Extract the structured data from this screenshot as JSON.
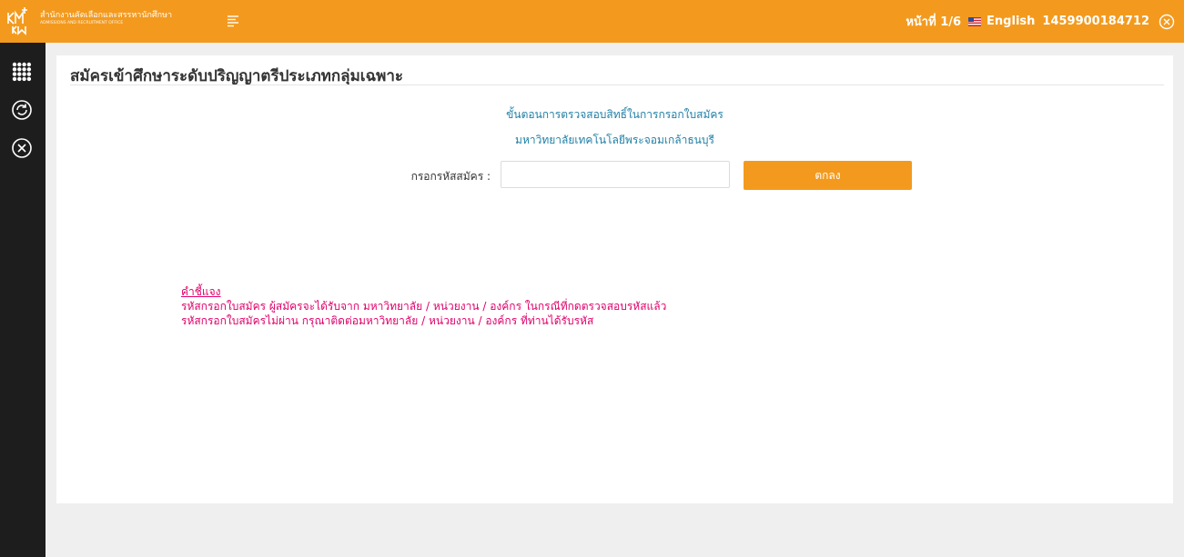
{
  "header": {
    "org_name_th": "สำนักงานคัดเลือกและสรรหานักศึกษา",
    "org_name_en": "ADMISSIONS AND RECRUITMENT OFFICE",
    "page_indicator": "หน้าที่ 1/6",
    "language_label": "English",
    "user_id": "1459900184712"
  },
  "sidebar": {
    "items": [
      {
        "icon": "apps-grid-icon"
      },
      {
        "icon": "refresh-icon"
      },
      {
        "icon": "close-circle-icon"
      }
    ]
  },
  "main": {
    "title": "สมัครเข้าศึกษาระดับปริญญาตรีประเภทกลุ่มเฉพาะ",
    "step_title": "ขั้นตอนการตรวจสอบสิทธิ์ในการกรอกใบสมัคร",
    "university": "มหาวิทยาลัยเทคโนโลยีพระจอมเกล้าธนบุรี",
    "form": {
      "code_label": "กรอกรหัสสมัคร :",
      "code_value": "",
      "code_placeholder": "",
      "submit_label": "ตกลง"
    },
    "notes": {
      "heading": "คำชี้แจง",
      "lines": [
        "รหัสกรอกใบสมัคร ผู้สมัครจะได้รับจาก มหาวิทยาลัย / หน่วยงาน / องค์กร ในกรณีที่กดตรวจสอบรหัสแล้ว",
        "รหัสกรอกใบสมัครไม่ผ่าน กรุณาติดต่อมหาวิทยาลัย / หน่วยงาน / องค์กร ที่ท่านได้รับรหัส"
      ]
    }
  },
  "colors": {
    "accent": "#f39a1e",
    "sidebar": "#1d1d1d",
    "info_text": "#1f7fa6",
    "notes_text": "#e0006a"
  }
}
